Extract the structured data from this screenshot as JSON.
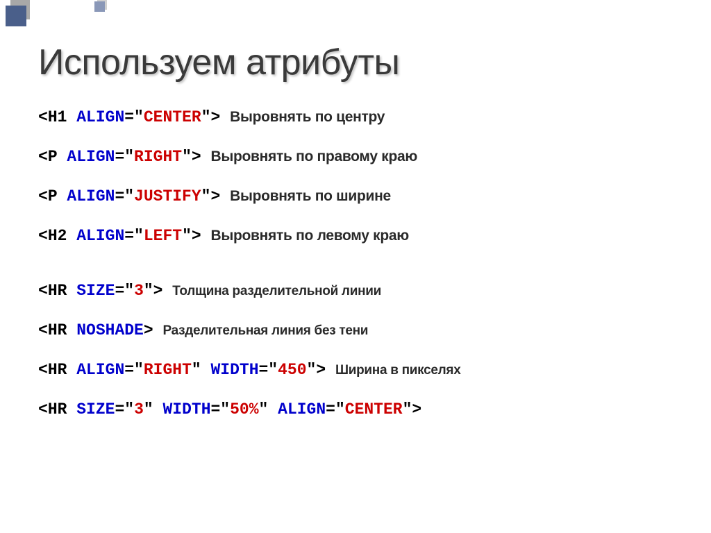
{
  "title": "Используем атрибуты",
  "lines": [
    {
      "parts": [
        {
          "cls": "mono black",
          "text": "<"
        },
        {
          "cls": "mono black",
          "text": "H1 "
        },
        {
          "cls": "mono blue",
          "text": "ALIGN"
        },
        {
          "cls": "mono black",
          "text": "=\""
        },
        {
          "cls": "mono red",
          "text": "CENTER"
        },
        {
          "cls": "mono black",
          "text": "\"> "
        }
      ],
      "desc": "Выровнять по центру",
      "descCls": "desc"
    },
    {
      "parts": [
        {
          "cls": "mono black",
          "text": "<"
        },
        {
          "cls": "mono black",
          "text": "P "
        },
        {
          "cls": "mono blue",
          "text": "ALIGN"
        },
        {
          "cls": "mono black",
          "text": "=\""
        },
        {
          "cls": "mono red",
          "text": "RIGHT"
        },
        {
          "cls": "mono black",
          "text": "\"> "
        }
      ],
      "desc": "Выровнять по правому краю",
      "descCls": "desc"
    },
    {
      "parts": [
        {
          "cls": "mono black",
          "text": "<"
        },
        {
          "cls": "mono black",
          "text": "P "
        },
        {
          "cls": "mono blue",
          "text": "ALIGN"
        },
        {
          "cls": "mono black",
          "text": "=\""
        },
        {
          "cls": "mono red",
          "text": "JUSTIFY"
        },
        {
          "cls": "mono black",
          "text": "\"> "
        }
      ],
      "desc": "Выровнять по ширине",
      "descCls": "desc"
    },
    {
      "parts": [
        {
          "cls": "mono black",
          "text": "<"
        },
        {
          "cls": "mono black",
          "text": "H2 "
        },
        {
          "cls": "mono blue",
          "text": "ALIGN"
        },
        {
          "cls": "mono black",
          "text": "=\""
        },
        {
          "cls": "mono red",
          "text": "LEFT"
        },
        {
          "cls": "mono black",
          "text": "\"> "
        }
      ],
      "desc": "Выровнять по левому краю",
      "descCls": "desc"
    },
    {
      "parts": [
        {
          "cls": "mono black",
          "text": "<"
        },
        {
          "cls": "mono black",
          "text": "HR "
        },
        {
          "cls": "mono blue",
          "text": "SIZE"
        },
        {
          "cls": "mono black",
          "text": "=\""
        },
        {
          "cls": "mono red",
          "text": "3"
        },
        {
          "cls": "mono black",
          "text": "\"> "
        }
      ],
      "desc": "Толщина разделительной линии",
      "descCls": "desc-sm"
    },
    {
      "parts": [
        {
          "cls": "mono black",
          "text": "<"
        },
        {
          "cls": "mono black",
          "text": "HR "
        },
        {
          "cls": "mono blue",
          "text": "NOSHADE"
        },
        {
          "cls": "mono black",
          "text": "> "
        }
      ],
      "desc": "Разделительная линия без тени",
      "descCls": "desc-sm"
    },
    {
      "parts": [
        {
          "cls": "mono black",
          "text": "<"
        },
        {
          "cls": "mono black",
          "text": "HR "
        },
        {
          "cls": "mono blue",
          "text": "ALIGN"
        },
        {
          "cls": "mono black",
          "text": "=\""
        },
        {
          "cls": "mono red",
          "text": "RIGHT"
        },
        {
          "cls": "mono black",
          "text": "\" "
        },
        {
          "cls": "mono blue",
          "text": "WIDTH"
        },
        {
          "cls": "mono black",
          "text": "=\""
        },
        {
          "cls": "mono red",
          "text": "450"
        },
        {
          "cls": "mono black",
          "text": "\"> "
        }
      ],
      "desc": "Ширина в пикселях",
      "descCls": "desc-sm"
    },
    {
      "parts": [
        {
          "cls": "mono black",
          "text": "<"
        },
        {
          "cls": "mono black",
          "text": "HR "
        },
        {
          "cls": "mono blue",
          "text": "SIZE"
        },
        {
          "cls": "mono black",
          "text": "=\""
        },
        {
          "cls": "mono red",
          "text": "3"
        },
        {
          "cls": "mono black",
          "text": "\" "
        },
        {
          "cls": "mono blue",
          "text": "WIDTH"
        },
        {
          "cls": "mono black",
          "text": "=\""
        },
        {
          "cls": "mono red",
          "text": "50%"
        },
        {
          "cls": "mono black",
          "text": "\" "
        },
        {
          "cls": "mono blue",
          "text": "ALIGN"
        },
        {
          "cls": "mono black",
          "text": "=\""
        },
        {
          "cls": "mono red",
          "text": "CENTER"
        },
        {
          "cls": "mono black",
          "text": "\">"
        }
      ],
      "desc": "",
      "descCls": ""
    }
  ]
}
